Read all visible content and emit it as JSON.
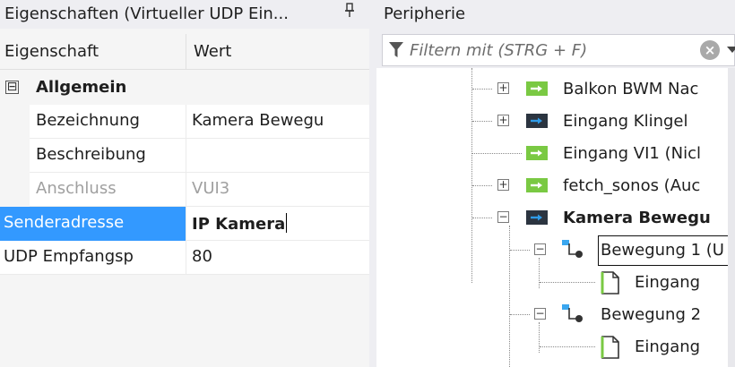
{
  "properties_panel": {
    "title": "Eigenschaften (Virtueller UDP Ein...",
    "pin_icon": "pin-icon",
    "headers": {
      "property": "Eigenschaft",
      "value": "Wert"
    },
    "category": {
      "toggle": "⊟",
      "label": "Allgemein"
    },
    "rows": [
      {
        "name": "Bezeichnung",
        "value": "Kamera Bewegu",
        "state": "normal"
      },
      {
        "name": "Beschreibung",
        "value": "",
        "state": "normal"
      },
      {
        "name": "Anschluss",
        "value": "VUI3",
        "state": "disabled"
      },
      {
        "name": "Senderadresse",
        "value": "IP Kamera",
        "state": "selected-editing"
      },
      {
        "name": "UDP Empfangsp",
        "value": "80",
        "state": "normal"
      }
    ]
  },
  "peripherie_panel": {
    "title": "Peripherie",
    "filter": {
      "placeholder": "Filtern mit (STRG + F)",
      "value": "",
      "clear_icon": "clear-icon",
      "dropdown_icon": "chevron-down-icon"
    },
    "tree": [
      {
        "label": "Balkon BWM Nac",
        "toggle": "+",
        "icon": "green-input-icon",
        "level": 0
      },
      {
        "label": "Eingang Klingel",
        "toggle": "+",
        "icon": "dark-input-icon",
        "level": 0
      },
      {
        "label": "Eingang VI1 (Nicl",
        "toggle": "",
        "icon": "green-input-icon",
        "level": 0
      },
      {
        "label": "fetch_sonos (Auc",
        "toggle": "+",
        "icon": "green-input-icon",
        "level": 0
      },
      {
        "label": "Kamera Bewegu",
        "toggle": "−",
        "icon": "dark-input-icon",
        "level": 0,
        "bold": true
      },
      {
        "label": "Bewegung 1 (U",
        "toggle": "−",
        "icon": "flag-node-icon",
        "level": 1,
        "focused": true
      },
      {
        "label": "Eingang",
        "toggle": "",
        "icon": "document-icon",
        "level": 2
      },
      {
        "label": "Bewegung 2",
        "toggle": "−",
        "icon": "flag-node-icon",
        "level": 1
      },
      {
        "label": "Eingang",
        "toggle": "",
        "icon": "document-icon",
        "level": 2
      }
    ],
    "colors": {
      "green": "#7ac943",
      "dark": "#2b3440",
      "arrow_blue": "#2f9be8",
      "flag_blue": "#3aa7f0"
    }
  }
}
